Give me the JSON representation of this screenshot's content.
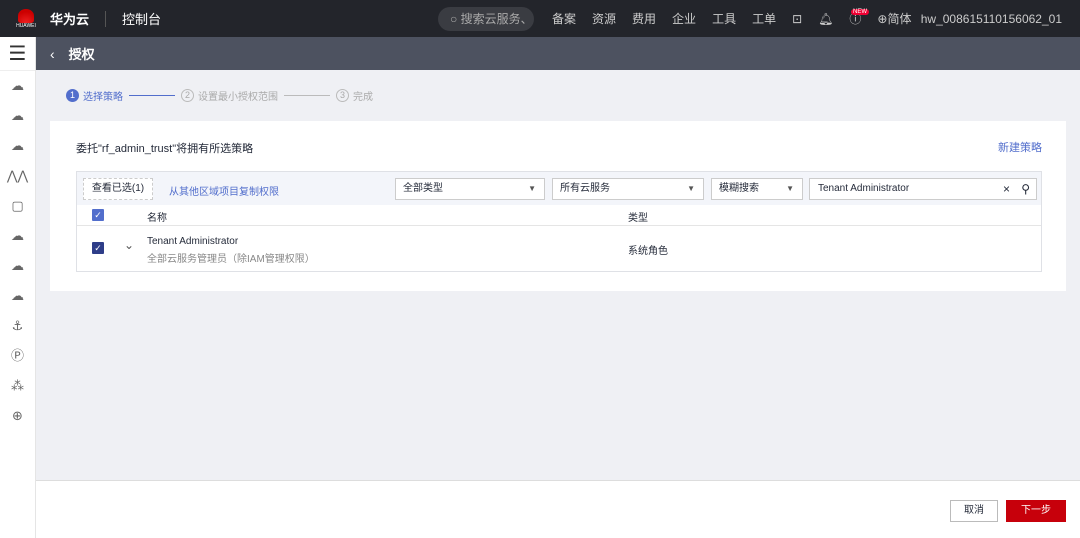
{
  "header": {
    "logo_text": "HUAWEI",
    "brand": "华为云",
    "console": "控制台",
    "search_placeholder": "搜索云服务、",
    "nav": [
      "备案",
      "资源",
      "费用",
      "企业",
      "工具",
      "工单"
    ],
    "new_badge": "NEW",
    "language": "简体",
    "user": "hw_008615110156062_01"
  },
  "page": {
    "title": "授权"
  },
  "steps": [
    {
      "num": "1",
      "label": "选择策略",
      "active": true
    },
    {
      "num": "2",
      "label": "设置最小授权范围",
      "active": false
    },
    {
      "num": "3",
      "label": "完成",
      "active": false
    }
  ],
  "card": {
    "description": "委托\"rf_admin_trust\"将拥有所选策略",
    "new_policy": "新建策略",
    "toolbar": {
      "view_selected": "查看已选(1)",
      "copy_link": "从其他区域项目复制权限",
      "type_select": "全部类型",
      "service_select": "所有云服务",
      "search_mode": "模糊搜索",
      "search_value": "Tenant Administrator"
    },
    "columns": [
      "名称",
      "类型"
    ],
    "rows": [
      {
        "name": "Tenant Administrator",
        "desc": "全部云服务管理员（除IAM管理权限）",
        "type": "系统角色",
        "checked": true
      }
    ]
  },
  "footer": {
    "cancel": "取消",
    "next": "下一步"
  },
  "colors": {
    "accent": "#526ecc",
    "primary_button": "#c7000b"
  }
}
